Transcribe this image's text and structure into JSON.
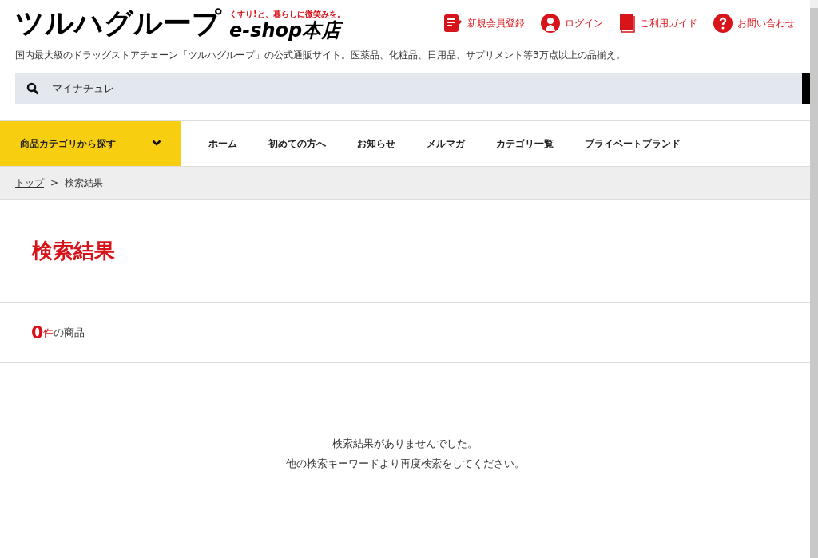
{
  "header": {
    "logo": "ツルハグループ",
    "tagline": "くすり!と、暮らしに微笑みを。",
    "shop_name": "e-shop本店",
    "links": [
      {
        "kind": "register",
        "label": "新規会員登録"
      },
      {
        "kind": "login",
        "label": "ログイン"
      },
      {
        "kind": "guide",
        "label": "ご利用ガイド"
      },
      {
        "kind": "contact",
        "label": "お問い合わせ"
      }
    ],
    "description": "国内最大級のドラッグストアチェーン「ツルハグループ」の公式通販サイト。医薬品、化粧品、日用品、サプリメント等3万点以上の品揃え。"
  },
  "search": {
    "value": "マイナチュレ"
  },
  "nav": {
    "category_button": "商品カテゴリから探す",
    "items": [
      {
        "label": "ホーム"
      },
      {
        "label": "初めての方へ"
      },
      {
        "label": "お知らせ"
      },
      {
        "label": "メルマガ"
      },
      {
        "label": "カテゴリ一覧"
      },
      {
        "label": "プライベートブランド"
      }
    ]
  },
  "breadcrumb": [
    {
      "label": "トップ",
      "link": true
    },
    {
      "label": "検索結果",
      "link": false
    }
  ],
  "breadcrumb_separator": ">",
  "page_title": "検索結果",
  "result_count": {
    "count": "0",
    "unit": "件",
    "label": "の商品"
  },
  "empty_message": [
    "検索結果がありませんでした。",
    "他の検索キーワードより再度検索をしてください。"
  ]
}
